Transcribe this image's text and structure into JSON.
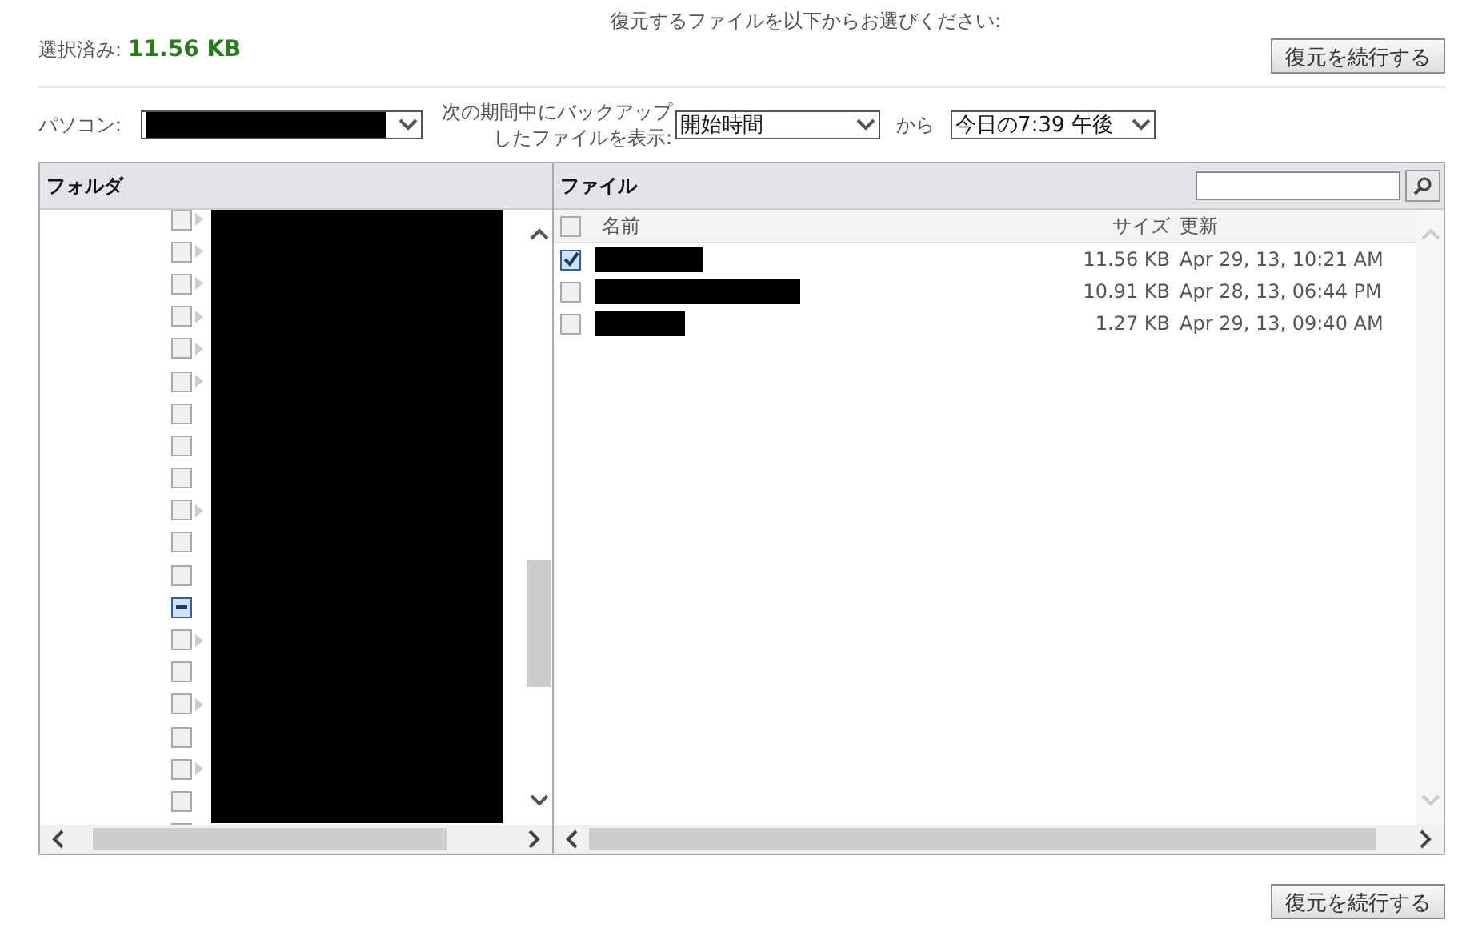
{
  "heading": "復元するファイルを以下からお選びください:",
  "selected_size": {
    "label": "選択済み:",
    "value": "11.56 KB"
  },
  "buttons": {
    "top": "復元を続行する",
    "bottom": "復元を続行する"
  },
  "filters": {
    "computer_label": "パソコン:",
    "period_label": "次の期間中にバックアップしたファイルを表示:",
    "period_value": "開始時間",
    "from_label": "から",
    "date_value": "今日の7:39 午後"
  },
  "folders": {
    "title": "フォルダ",
    "items": [
      {
        "partial": false,
        "expandable": true
      },
      {
        "partial": false,
        "expandable": true
      },
      {
        "partial": false,
        "expandable": true
      },
      {
        "partial": false,
        "expandable": true
      },
      {
        "partial": false,
        "expandable": true
      },
      {
        "partial": false,
        "expandable": true
      },
      {
        "partial": false,
        "expandable": false
      },
      {
        "partial": false,
        "expandable": false
      },
      {
        "partial": false,
        "expandable": false
      },
      {
        "partial": false,
        "expandable": true
      },
      {
        "partial": false,
        "expandable": false
      },
      {
        "partial": false,
        "expandable": false
      },
      {
        "partial": true,
        "expandable": false
      },
      {
        "partial": false,
        "expandable": true
      },
      {
        "partial": false,
        "expandable": false
      },
      {
        "partial": false,
        "expandable": true
      },
      {
        "partial": false,
        "expandable": false
      },
      {
        "partial": false,
        "expandable": true
      },
      {
        "partial": false,
        "expandable": false
      },
      {
        "partial": false
      }
    ]
  },
  "files": {
    "title": "ファイル",
    "columns": [
      "名前",
      "サイズ",
      "更新"
    ],
    "all_checked": false,
    "rows": [
      {
        "checked": true,
        "size": "11.56 KB",
        "modified": "Apr 29, 13, 10:21 AM"
      },
      {
        "checked": false,
        "size": "10.91 KB",
        "modified": "Apr 28, 13, 06:44 PM"
      },
      {
        "checked": false,
        "size": "1.27 KB",
        "modified": "Apr 29, 13, 09:40 AM"
      }
    ]
  }
}
